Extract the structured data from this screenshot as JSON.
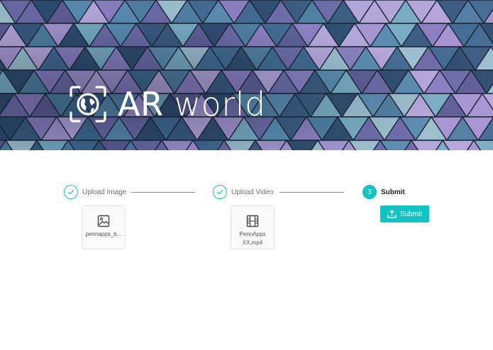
{
  "hero": {
    "title_ar": "AR",
    "title_rest": " world"
  },
  "steps": [
    {
      "label": "Upload Image",
      "state": "done"
    },
    {
      "label": "Upload Video",
      "state": "done"
    },
    {
      "number": "3",
      "label": "Submit",
      "state": "current"
    }
  ],
  "uploads": [
    {
      "icon": "image-icon",
      "name": "pennapps_b..."
    },
    {
      "icon": "film-icon",
      "name": "PennApps XX.mp4"
    }
  ],
  "submit_button": {
    "label": "Submit",
    "icon": "upload-icon"
  },
  "colors": {
    "accent": "#13c2c2"
  }
}
